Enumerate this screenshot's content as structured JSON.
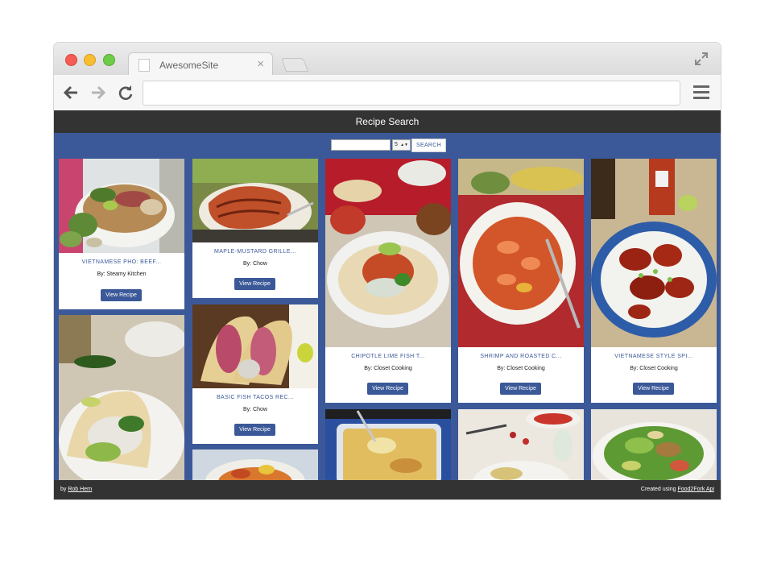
{
  "browser": {
    "tab_title": "AwesomeSite",
    "tab_close": "×",
    "url": ""
  },
  "site": {
    "title": "Recipe Search"
  },
  "search": {
    "placeholder": "",
    "count_value": "5",
    "count_arrows": "▲▼",
    "button_label": "SEARCH"
  },
  "recipes": [
    {
      "title": "VIETNAMESE PHO: BEEF...",
      "author": "By: Steamy Kitchen",
      "button": "View Recipe",
      "image": "pho-soup-image"
    },
    {
      "title": "MAPLE-MUSTARD GRILLE...",
      "author": "By: Chow",
      "button": "View Recipe",
      "image": "grilled-salmon-image"
    },
    {
      "title": "CHIPOTLE LIME FISH T...",
      "author": "By: Closet Cooking",
      "button": "View Recipe",
      "image": "fish-tacos-plate-image"
    },
    {
      "title": "SHRIMP AND ROASTED C...",
      "author": "By: Closet Cooking",
      "button": "View Recipe",
      "image": "shrimp-corn-chowder-image"
    },
    {
      "title": "VIETNAMESE STYLE SPI...",
      "author": "By: Closet Cooking",
      "button": "View Recipe",
      "image": "spicy-wings-image"
    },
    {
      "title": "BASIC FISH TACOS REC...",
      "author": "By: Chow",
      "button": "View Recipe",
      "image": "basic-fish-tacos-image"
    },
    {
      "title": "",
      "author": "",
      "button": "",
      "image": "fish-tacos-image"
    },
    {
      "title": "",
      "author": "",
      "button": "",
      "image": "shrimp-bowl-image"
    },
    {
      "title": "",
      "author": "",
      "button": "",
      "image": "casserole-image"
    },
    {
      "title": "",
      "author": "",
      "button": "",
      "image": "tacos-table-image"
    },
    {
      "title": "",
      "author": "",
      "button": "",
      "image": "salad-image"
    }
  ],
  "footer": {
    "by_prefix": "by",
    "author_link": "Rob Hern",
    "created_prefix": "Created using",
    "api_link": "Food2Fork Api"
  },
  "colors": {
    "brand_blue": "#3b5998",
    "header_dark": "#333333",
    "card_white": "#ffffff"
  },
  "icons": [
    "back-arrow-icon",
    "forward-arrow-icon",
    "reload-icon",
    "hamburger-menu-icon",
    "fullscreen-icon",
    "page-icon"
  ]
}
